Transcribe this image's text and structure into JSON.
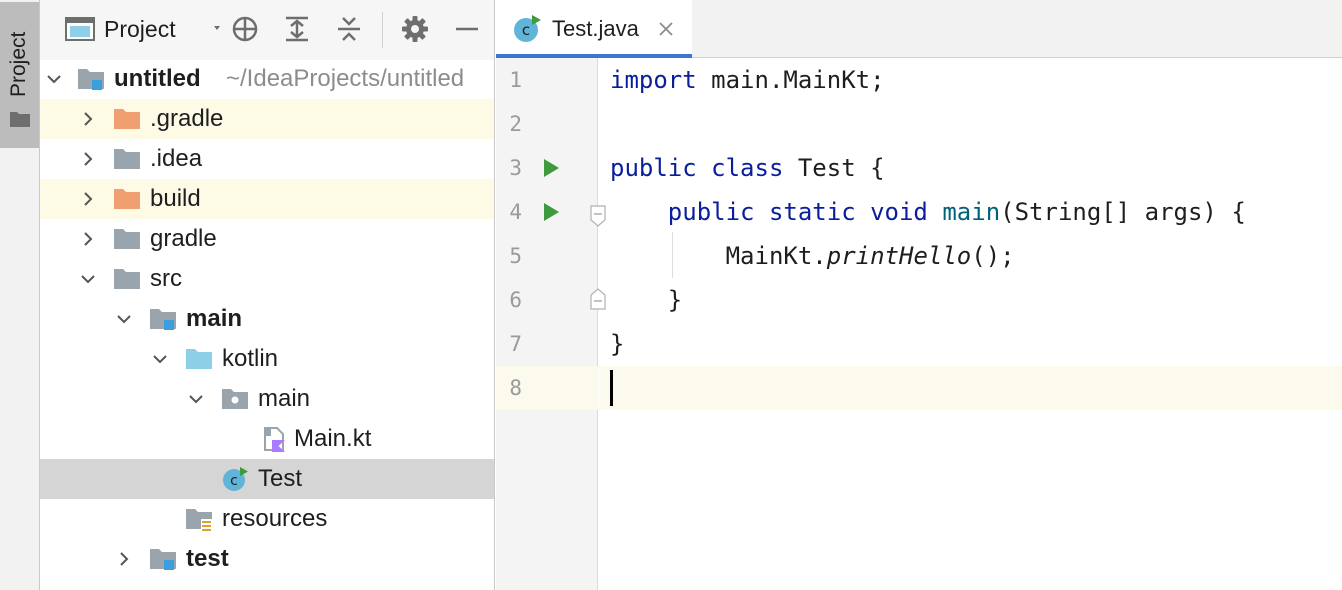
{
  "stripe": {
    "label": "Project"
  },
  "panel": {
    "title": "Project",
    "toolbar": [
      "locate-icon",
      "expand-all-icon",
      "collapse-all-icon",
      "gear-icon",
      "minimize-icon"
    ]
  },
  "tree": [
    {
      "label": "untitled",
      "path": "~/IdeaProjects/untitled",
      "bold": true
    },
    {
      "label": ".gradle"
    },
    {
      "label": ".idea"
    },
    {
      "label": "build"
    },
    {
      "label": "gradle"
    },
    {
      "label": "src"
    },
    {
      "label": "main",
      "bold": true
    },
    {
      "label": "kotlin"
    },
    {
      "label": "main"
    },
    {
      "label": "Main.kt"
    },
    {
      "label": "Test"
    },
    {
      "label": "resources"
    },
    {
      "label": "test",
      "bold": true
    }
  ],
  "editor": {
    "tab": {
      "label": "Test.java"
    },
    "line_numbers": [
      "1",
      "2",
      "3",
      "4",
      "5",
      "6",
      "7",
      "8"
    ],
    "code": {
      "l1_kw": "import",
      "l1_rest": " main.MainKt;",
      "l3_kw": "public class",
      "l3_rest": " Test {",
      "l4_indent": "    ",
      "l4_kw": "public static void",
      "l4_sp": " ",
      "l4_method": "main",
      "l4_rest": "(String[] args) {",
      "l5_indent": "        ",
      "l5_obj": "MainKt.",
      "l5_call": "printHello",
      "l5_rest": "();",
      "l6": "    }",
      "l7": "}"
    }
  },
  "colors": {
    "keyword": "#0a1e9c",
    "method": "#00627a",
    "excluded_folder": "#f0a070",
    "source_folder": "#8ecfe8",
    "current_line": "#fcfaed",
    "selection": "#d5d5d5",
    "tab_underline": "#3d74d0",
    "run_arrow": "#3d9a3d"
  }
}
